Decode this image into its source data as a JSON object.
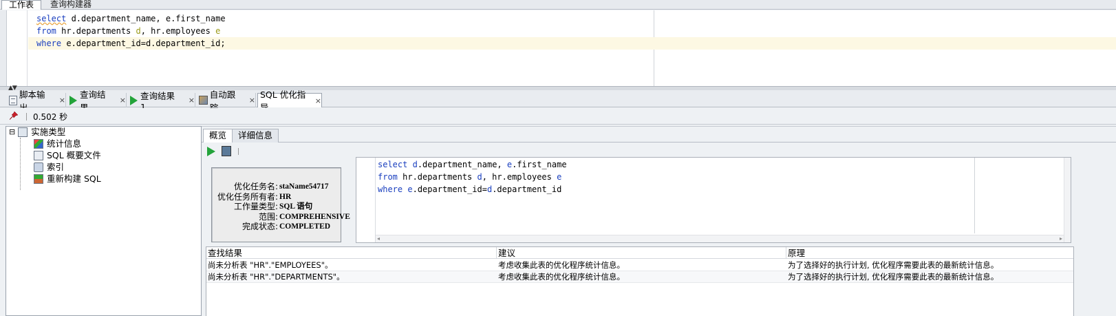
{
  "top_tabs": {
    "worksheet": "工作表",
    "query_builder": "查询构建器"
  },
  "editor": {
    "line1": {
      "kw": "select",
      "rest": " d.department_name, e.first_name"
    },
    "line2": {
      "kw": "from",
      "mid": " hr.departments ",
      "alias1": "d",
      "mid2": ", hr.employees ",
      "alias2": "e"
    },
    "line3": {
      "kw": "where",
      "rest": " e.department_id=d.department_id;"
    }
  },
  "result_tabs": [
    {
      "label": "脚本输出",
      "close": "×",
      "icon": "script-output-icon"
    },
    {
      "label": "查询结果",
      "close": "×",
      "icon": "run-query-icon"
    },
    {
      "label": "查询结果 1",
      "close": "×",
      "icon": "run-query-icon"
    },
    {
      "label": "自动跟踪",
      "close": "×",
      "icon": "autotrace-icon"
    },
    {
      "label": "SQL 优化指导",
      "close": "×",
      "icon": ""
    }
  ],
  "status": {
    "elapsed": "0.502 秒"
  },
  "tree": {
    "root": "实施类型",
    "items": [
      "统计信息",
      "SQL 概要文件",
      "索引",
      "重新构建 SQL"
    ],
    "expander": "⊟"
  },
  "sub_tabs": {
    "overview": "概览",
    "details": "详细信息"
  },
  "summary": [
    {
      "key": "优化任务名:",
      "value": "staName54717"
    },
    {
      "key": "优化任务所有者:",
      "value": "HR"
    },
    {
      "key": "工作量类型:",
      "value": "SQL 语句"
    },
    {
      "key": "范围:",
      "value": "COMPREHENSIVE"
    },
    {
      "key": "完成状态:",
      "value": "COMPLETED"
    }
  ],
  "sql": {
    "line1": {
      "kw": "select",
      "a": " ",
      "alias1": "d",
      "b": ".department_name, ",
      "alias2": "e",
      "c": ".first_name"
    },
    "line2": {
      "kw": "from",
      "a": " hr.departments ",
      "alias1": "d",
      "b": ", hr.employees ",
      "alias2": "e"
    },
    "line3": {
      "kw": "where",
      "a": " ",
      "alias1": "e",
      "b": ".department_id=",
      "alias2": "d",
      "c": ".department_id"
    }
  },
  "findings": {
    "headers": [
      "查找结果",
      "建议",
      "原理"
    ],
    "rows": [
      [
        "尚未分析表 \"HR\".\"EMPLOYEES\"。",
        "考虑收集此表的优化程序统计信息。",
        "为了选择好的执行计划, 优化程序需要此表的最新统计信息。"
      ],
      [
        "尚未分析表 \"HR\".\"DEPARTMENTS\"。",
        "考虑收集此表的优化程序统计信息。",
        "为了选择好的执行计划, 优化程序需要此表的最新统计信息。"
      ]
    ]
  },
  "colors": {
    "keyword": "#1a3fbf",
    "alias": "#9a9a17",
    "run_green": "#23a33a",
    "current_line": "#fdf8e3"
  }
}
